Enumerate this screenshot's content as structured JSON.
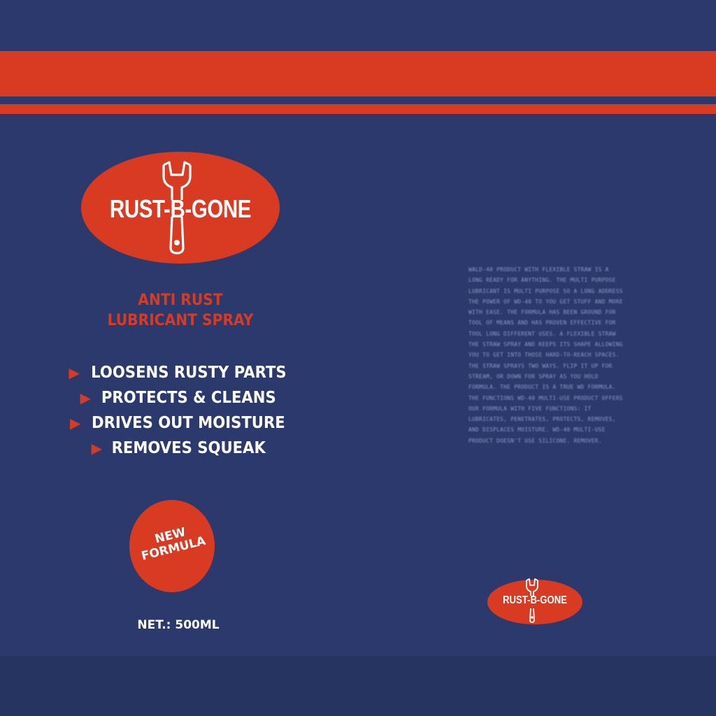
{
  "brand": {
    "name": "RUST-B-GONE",
    "colors": {
      "background": "#2b396c",
      "accent": "#d93a22",
      "text": "#ffffff"
    },
    "logo_icon": "wrench-icon"
  },
  "product": {
    "subtitle_line1": "ANTI RUST",
    "subtitle_line2": "LUBRICANT SPRAY"
  },
  "features": [
    "LOOSENS RUSTY PARTS",
    "PROTECTS & CLEANS",
    "DRIVES OUT MOISTURE",
    "REMOVES SQUEAK"
  ],
  "feature_bullet_icon": "triangle-arrow-icon",
  "badge": {
    "line1": "NEW",
    "line2": "FORMULA"
  },
  "net_volume": "NET.: 500ML",
  "description": "WALD-40 PRODUCT WITH FLEXIBLE STRAW IS A LONG READY FOR ANYTHING. THE MULTI PURPOSE LUBRICANT IS MULTI PURPOSE SO A LONG ADDRESS THE POWER OF WD-40 TO YOU GET STUFF AND MORE WITH EASE. THE FORMULA HAS BEEN GROUND FOR TOOL OF MEANS AND HAS PROVEN EFFECTIVE FOR TOOL LONG DIFFERENT USES. A FLEXIBLE STRAW THE STRAW SPRAY AND KEEPS ITS SHAPE ALLOWING YOU TO GET INTO THOSE HARD-TO-REACH SPACES. THE STRAW SPRAYS TWO WAYS. FLIP IT UP FOR STREAM, OR DOWN FOR SPRAY AS YOU HOLD FORMULA. THE PRODUCT IS A TRUE WD FORMULA. THE FUNCTIONS WD-40 MULTI-USE PRODUCT OFFERS OUR FORMULA WITH FIVE FUNCTIONS: IT LUBRICATES, PENETRATES, PROTECTS, REMOVES, AND DISPLACES MOISTURE. WD-40 MULTI-USE PRODUCT DOESN'T USE SILICONE. REMOVER."
}
